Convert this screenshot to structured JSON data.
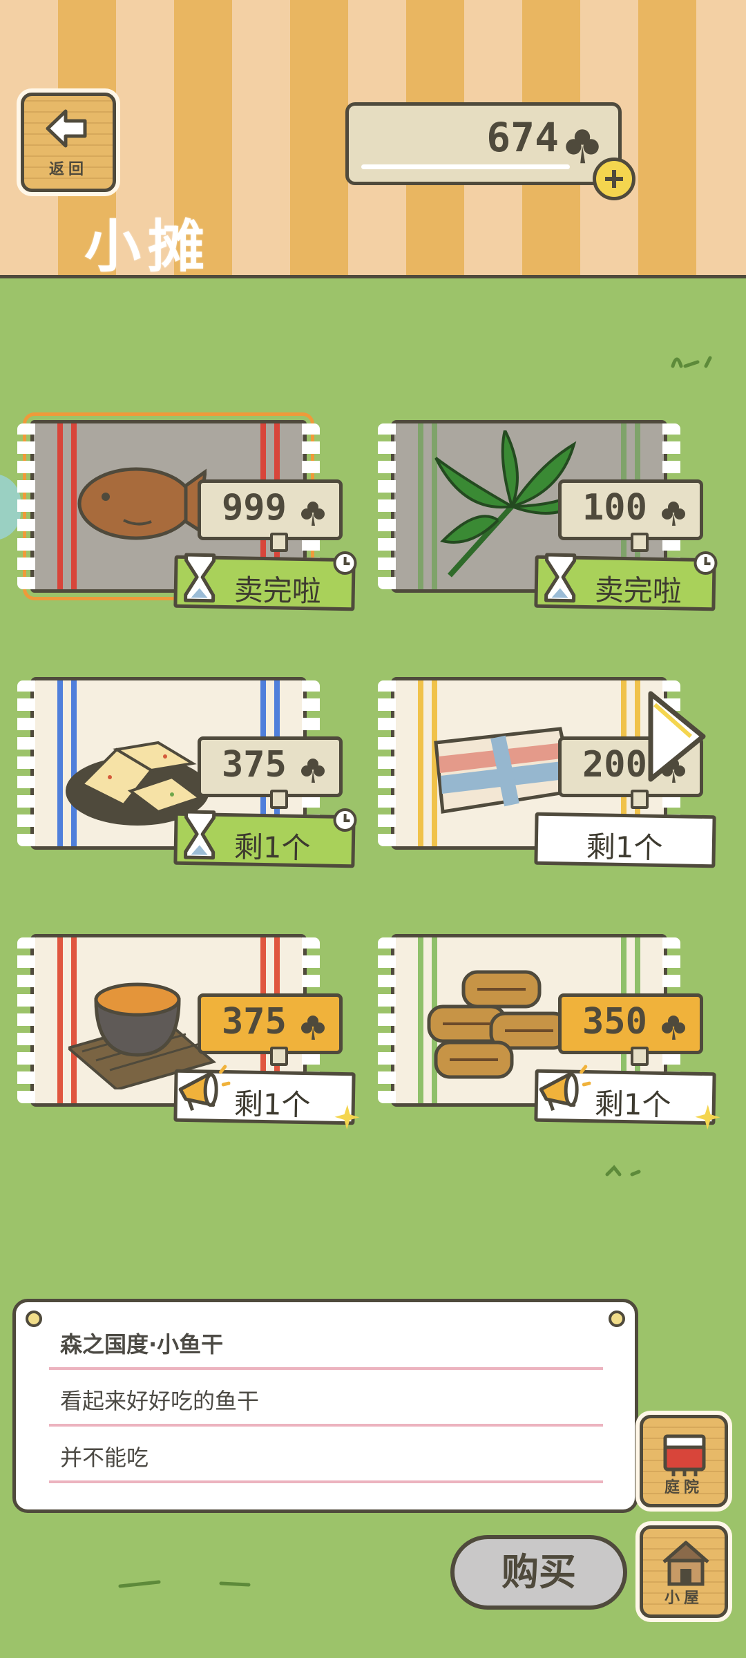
{
  "header": {
    "back_label": "返回",
    "title": "小摊",
    "coins": "674",
    "currency_icon": "clover-icon"
  },
  "items": [
    {
      "price": "999",
      "status": "卖完啦",
      "status_style": "sold-out",
      "badge_icon": "hourglass-icon",
      "mat": "gray",
      "food": "dried-fish-icon",
      "selected": true
    },
    {
      "price": "100",
      "status": "卖完啦",
      "status_style": "sold-out",
      "badge_icon": "hourglass-icon",
      "mat": "gray",
      "food": "bamboo-leaf-icon",
      "selected": false
    },
    {
      "price": "375",
      "status": "剩1个",
      "status_style": "limited",
      "badge_icon": "hourglass-icon",
      "mat": "cream",
      "food": "scallion-bread-icon",
      "selected": false
    },
    {
      "price": "200",
      "status": "剩1个",
      "status_style": "plain",
      "badge_icon": "",
      "mat": "cream",
      "food": "folded-cloth-icon",
      "selected": false
    },
    {
      "price": "375",
      "status": "剩1个",
      "status_style": "promo",
      "badge_icon": "megaphone-icon",
      "mat": "cream",
      "food": "soup-bowl-icon",
      "selected": false
    },
    {
      "price": "350",
      "status": "剩1个",
      "status_style": "promo",
      "badge_icon": "megaphone-icon",
      "mat": "cream",
      "food": "roll-cake-icon",
      "selected": false
    }
  ],
  "info": {
    "name": "森之国度·小鱼干",
    "line1": "看起来好好吃的鱼干",
    "line2": "并不能吃"
  },
  "actions": {
    "buy_label": "购买",
    "yard_label": "庭院",
    "house_label": "小屋"
  },
  "colors": {
    "grass": "#9cc36a",
    "stripe_light": "#f3d0a4",
    "stripe_dark": "#e9b661",
    "outline": "#4f4a3c",
    "price_highlight": "#f0b23b",
    "status_green": "#a9d15a"
  }
}
